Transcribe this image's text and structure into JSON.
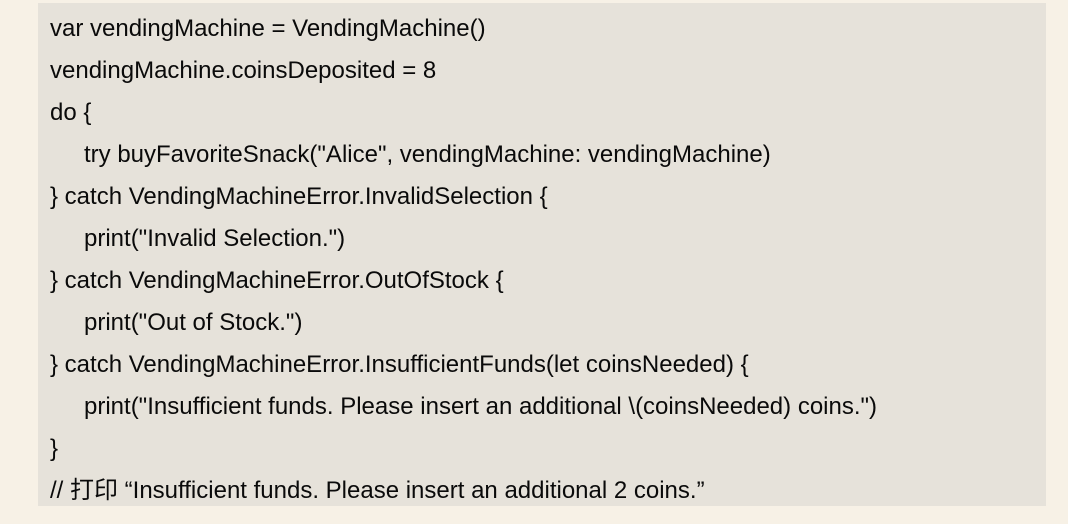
{
  "code": {
    "lines": [
      {
        "text": "var vendingMachine = VendingMachine()",
        "indent": false
      },
      {
        "text": "vendingMachine.coinsDeposited = 8",
        "indent": false
      },
      {
        "text": "do {",
        "indent": false
      },
      {
        "text": "try buyFavoriteSnack(\"Alice\", vendingMachine: vendingMachine)",
        "indent": true
      },
      {
        "text": "} catch VendingMachineError.InvalidSelection {",
        "indent": false
      },
      {
        "text": "print(\"Invalid Selection.\")",
        "indent": true
      },
      {
        "text": "} catch VendingMachineError.OutOfStock {",
        "indent": false
      },
      {
        "text": "print(\"Out of Stock.\")",
        "indent": true
      },
      {
        "text": "} catch VendingMachineError.InsufficientFunds(let coinsNeeded) {",
        "indent": false
      },
      {
        "text": "print(\"Insufficient funds. Please insert an additional \\(coinsNeeded) coins.\")",
        "indent": true
      },
      {
        "text": "}",
        "indent": false
      },
      {
        "text": "// 打印 “Insufficient funds. Please insert an additional 2 coins.”",
        "indent": false
      }
    ]
  }
}
